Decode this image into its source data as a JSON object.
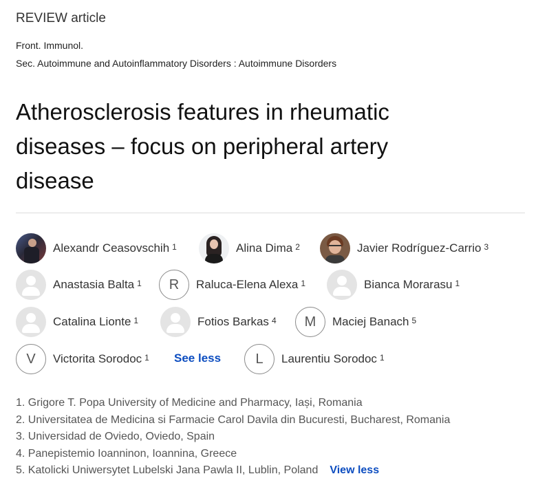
{
  "article": {
    "type": "REVIEW article",
    "journal": "Front. Immunol.",
    "section": "Sec. Autoimmune and Autoinflammatory Disorders : Autoimmune Disorders",
    "title_lines": [
      "Atherosclerosis features in rheumatic",
      "diseases – focus on peripheral artery",
      "disease"
    ]
  },
  "authors": [
    {
      "name": "Alexandr Ceasovschih",
      "affil": "1",
      "avatar": "photo"
    },
    {
      "name": "Alina Dima",
      "affil": "2",
      "avatar": "photo"
    },
    {
      "name": "Javier Rodríguez-Carrio",
      "affil": "3",
      "avatar": "photo"
    },
    {
      "name": "Anastasia Balta",
      "affil": "1",
      "avatar": "default"
    },
    {
      "name": "Raluca-Elena Alexa",
      "affil": "1",
      "avatar": "R"
    },
    {
      "name": "Bianca Morarasu",
      "affil": "1",
      "avatar": "default"
    },
    {
      "name": "Catalina Lionte",
      "affil": "1",
      "avatar": "default"
    },
    {
      "name": "Fotios Barkas",
      "affil": "4",
      "avatar": "default"
    },
    {
      "name": "Maciej Banach",
      "affil": "5",
      "avatar": "M"
    },
    {
      "name": "Victorita Sorodoc",
      "affil": "1",
      "avatar": "V"
    },
    {
      "name": "Laurentiu Sorodoc",
      "affil": "1",
      "avatar": "L"
    }
  ],
  "see_less_label": "See less",
  "affiliations": [
    "1. Grigore T. Popa University of Medicine and Pharmacy, Iași, Romania",
    "2. Universitatea de Medicina si Farmacie Carol Davila din Bucuresti, Bucharest, Romania",
    "3. Universidad de Oviedo, Oviedo, Spain",
    "4. Panepistemio Ioanninon, Ioannina, Greece",
    "5. Katolicki Uniwersytet Lubelski Jana Pawla II, Lublin, Poland"
  ],
  "view_less_label": "View less"
}
